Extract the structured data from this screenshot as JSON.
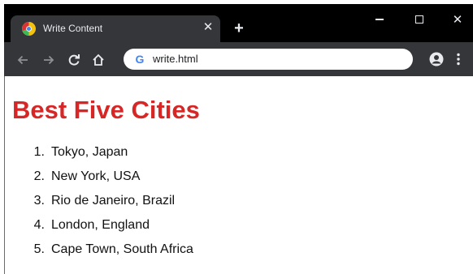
{
  "tab": {
    "title": "Write Content",
    "close_glyph": "✕"
  },
  "new_tab_glyph": "+",
  "window_controls": {
    "close_glyph": "✕"
  },
  "omnibox": {
    "url": "write.html",
    "search_engine_glyph": "G"
  },
  "page": {
    "heading": "Best Five Cities",
    "heading_color": "#d62626",
    "cities": [
      {
        "number": "1.",
        "name": "Tokyo, Japan"
      },
      {
        "number": "2.",
        "name": "New York, USA"
      },
      {
        "number": "3.",
        "name": "Rio de Janeiro, Brazil"
      },
      {
        "number": "4.",
        "name": "London, England"
      },
      {
        "number": "5.",
        "name": "Cape Town, South Africa"
      }
    ]
  },
  "icons": {
    "favicon": "chrome-favicon",
    "back": "arrow-left-icon",
    "forward": "arrow-right-icon",
    "reload": "reload-icon",
    "home": "home-icon",
    "account": "account-icon",
    "menu": "kebab-menu-icon"
  },
  "colors": {
    "titlebar": "#000000",
    "toolbar": "#35363a",
    "omnibox": "#ffffff"
  }
}
